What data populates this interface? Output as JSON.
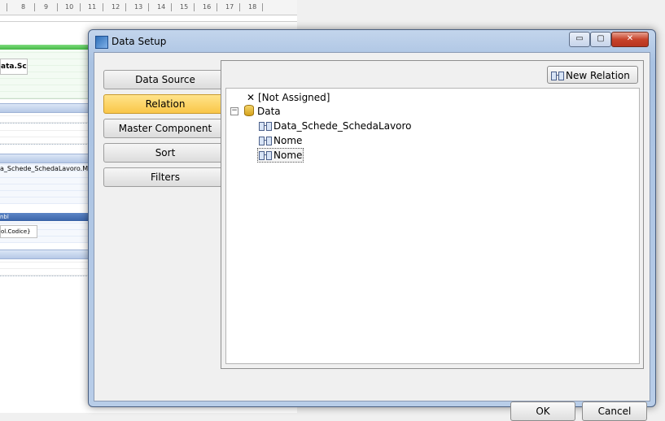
{
  "ruler": {
    "ticks": [
      "8",
      "9",
      "10",
      "11",
      "12",
      "13",
      "14",
      "15",
      "16",
      "17",
      "18"
    ]
  },
  "designer": {
    "data_field": "ata.Sch",
    "model_field": "a_Schede_SchedaLavoro.Model",
    "navy_band": "nbl",
    "codice_field": "ol.Codice}"
  },
  "dialog": {
    "title": "Data Setup",
    "controls": {
      "minimize": "▭",
      "maximize": "▢",
      "close": "✕"
    },
    "nav": [
      {
        "label": "Data Source"
      },
      {
        "label": "Relation"
      },
      {
        "label": "Master Component"
      },
      {
        "label": "Sort"
      },
      {
        "label": "Filters"
      }
    ],
    "new_relation_label": "New Relation",
    "tree": {
      "not_assigned": "[Not Assigned]",
      "root": "Data",
      "root_expander": "−",
      "children": [
        "Data_Schede_SchedaLavoro",
        "Nome",
        "Nome"
      ]
    },
    "ok_label": "OK",
    "cancel_label": "Cancel"
  }
}
